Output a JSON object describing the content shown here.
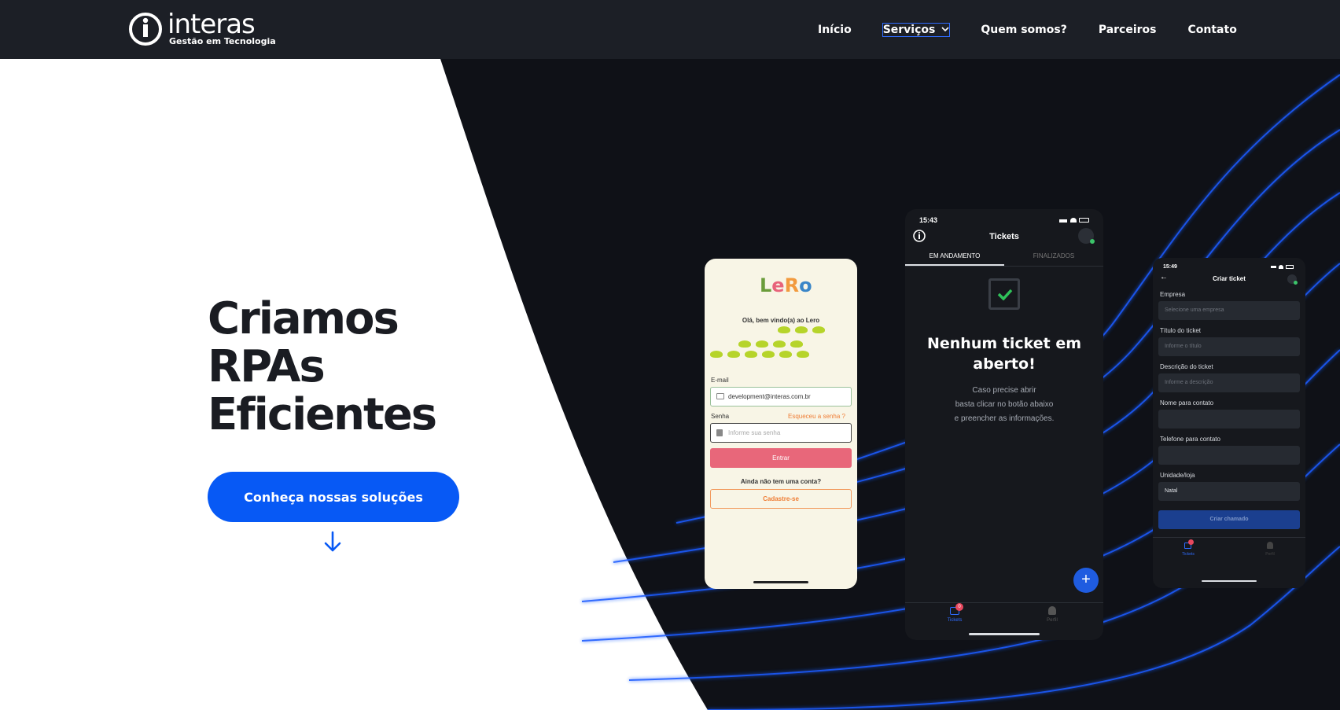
{
  "brand": {
    "name": "interas",
    "tagline": "Gestão em Tecnologia"
  },
  "nav": {
    "items": [
      "Início",
      "Serviços",
      "Quem somos?",
      "Parceiros",
      "Contato"
    ]
  },
  "hero": {
    "line1": "Criamos",
    "line2": "RPAs",
    "line3": "Eficientes",
    "cta": "Conheça nossas soluções"
  },
  "colors": {
    "topbar": "#1c1f26",
    "dark": "#0f1117",
    "accent": "#0759f5",
    "lines": "#1a5cff"
  },
  "phone1": {
    "logo": "LeRo",
    "welcome": "Olá, bem vindo(a) ao Lero",
    "email_label": "E-mail",
    "email_value": "development@interas.com.br",
    "password_label": "Senha",
    "forgot": "Esqueceu a senha ?",
    "password_placeholder": "Informe sua senha",
    "enter": "Entrar",
    "no_account": "Ainda não tem uma conta?",
    "signup": "Cadastre-se"
  },
  "phone2": {
    "time": "15:43",
    "title": "Tickets",
    "tab1": "EM ANDAMENTO",
    "tab2": "FINALIZADOS",
    "empty_title_1": "Nenhum ticket em",
    "empty_title_2": "aberto!",
    "empty_text_1": "Caso precise abrir",
    "empty_text_2": "basta clicar no botão abaixo",
    "empty_text_3": "e preencher as informações.",
    "tab_tickets": "Tickets",
    "tab_profile": "Perfil",
    "badge": "0"
  },
  "phone3": {
    "time": "15:49",
    "title": "Criar ticket",
    "f1_label": "Empresa",
    "f1_ph": "Selecione uma empresa",
    "f2_label": "Título do ticket",
    "f2_ph": "Informe o título",
    "f3_label": "Descrição do ticket",
    "f3_ph": "Informe a descrição",
    "f4_label": "Nome para contato",
    "f5_label": "Telefone para contato",
    "f6_label": "Unidade/loja",
    "f6_value": "Natal",
    "submit": "Criar chamado",
    "tab_tickets": "Tickets",
    "tab_profile": "Perfil"
  }
}
